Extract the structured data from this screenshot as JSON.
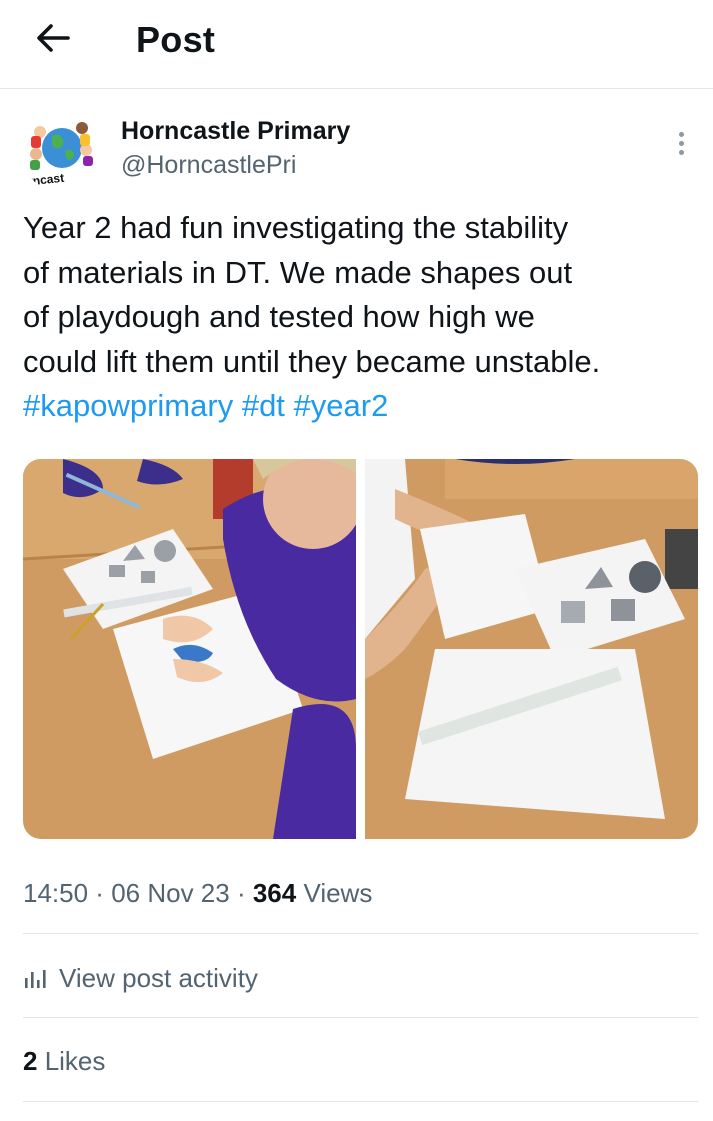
{
  "header": {
    "title": "Post",
    "back_icon": "arrow-left-icon"
  },
  "author": {
    "name": "Horncastle Primary",
    "handle": "@HorncastlePri",
    "avatar_text": "rncast",
    "more_icon": "more-vertical-icon"
  },
  "post": {
    "lines": [
      "Year 2 had fun investigating the stability",
      "of materials in DT. We made shapes out",
      "of playdough and tested how high we",
      "could lift them until they became unstable."
    ],
    "hashtags": [
      "#kapowprimary",
      "#dt",
      "#year2"
    ]
  },
  "meta": {
    "time": "14:50",
    "sep1": " · ",
    "date": "06 Nov 23",
    "sep2": " · ",
    "views_count": "364",
    "views_label": " Views"
  },
  "activity": {
    "label": "View post activity",
    "icon": "analytics-bars-icon"
  },
  "likes": {
    "count": "2",
    "label": " Likes"
  },
  "colors": {
    "accent": "#1d9bf0",
    "text": "#0f1419",
    "secondary": "#536471",
    "divider": "#e1e6ea"
  }
}
